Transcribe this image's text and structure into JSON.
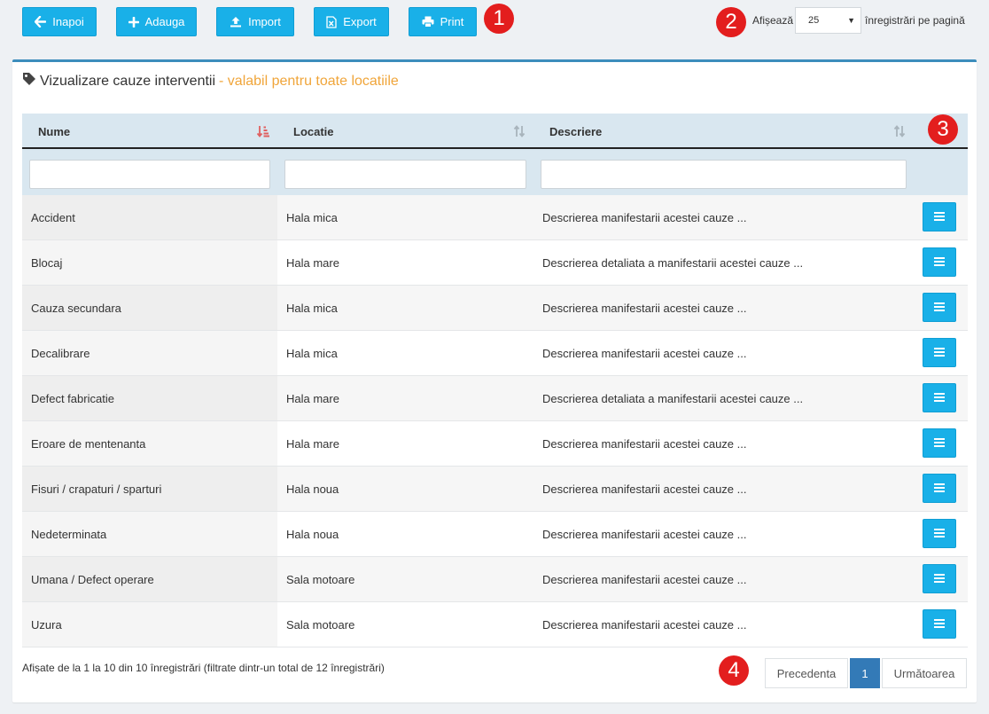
{
  "toolbar": {
    "back_label": "Inapoi",
    "add_label": "Adauga",
    "import_label": "Import",
    "export_label": "Export",
    "print_label": "Print"
  },
  "annotations": [
    "1",
    "2",
    "3",
    "4"
  ],
  "page_size": {
    "label_before": "Afișează",
    "value": "25",
    "label_after": "înregistrări pe pagină"
  },
  "panel": {
    "title": "Vizualizare cauze interventii",
    "subtitle": "- valabil pentru toate locatiile"
  },
  "table": {
    "columns": [
      "Nume",
      "Locatie",
      "Descriere"
    ],
    "rows": [
      {
        "nume": "Accident",
        "locatie": "Hala mica",
        "descriere": "Descrierea manifestarii acestei cauze ..."
      },
      {
        "nume": "Blocaj",
        "locatie": "Hala mare",
        "descriere": "Descrierea detaliata a manifestarii acestei cauze ..."
      },
      {
        "nume": "Cauza secundara",
        "locatie": "Hala mica",
        "descriere": "Descrierea manifestarii acestei cauze ..."
      },
      {
        "nume": "Decalibrare",
        "locatie": "Hala mica",
        "descriere": "Descrierea manifestarii acestei cauze ..."
      },
      {
        "nume": "Defect fabricatie",
        "locatie": "Hala mare",
        "descriere": "Descrierea detaliata a manifestarii acestei cauze ..."
      },
      {
        "nume": "Eroare de mentenanta",
        "locatie": "Hala mare",
        "descriere": "Descrierea manifestarii acestei cauze ..."
      },
      {
        "nume": "Fisuri / crapaturi / sparturi",
        "locatie": "Hala noua",
        "descriere": "Descrierea manifestarii acestei cauze ..."
      },
      {
        "nume": "Nedeterminata",
        "locatie": "Hala noua",
        "descriere": "Descrierea manifestarii acestei cauze ..."
      },
      {
        "nume": "Umana / Defect operare",
        "locatie": "Sala motoare",
        "descriere": "Descrierea manifestarii acestei cauze ..."
      },
      {
        "nume": "Uzura",
        "locatie": "Sala motoare",
        "descriere": "Descrierea manifestarii acestei cauze ..."
      }
    ]
  },
  "footer": {
    "info": "Afișate de la 1 la 10 din 10 înregistrări (filtrate dintr-un total de 12 înregistrări)"
  },
  "pagination": {
    "prev_label": "Precedenta",
    "current_page": "1",
    "next_label": "Următoarea"
  },
  "colors": {
    "button": "#19b0e8",
    "badge": "#e31e1e",
    "subtitle": "#f0a53a",
    "header_bg": "#d9e7f0",
    "active_page": "#337ab7"
  }
}
